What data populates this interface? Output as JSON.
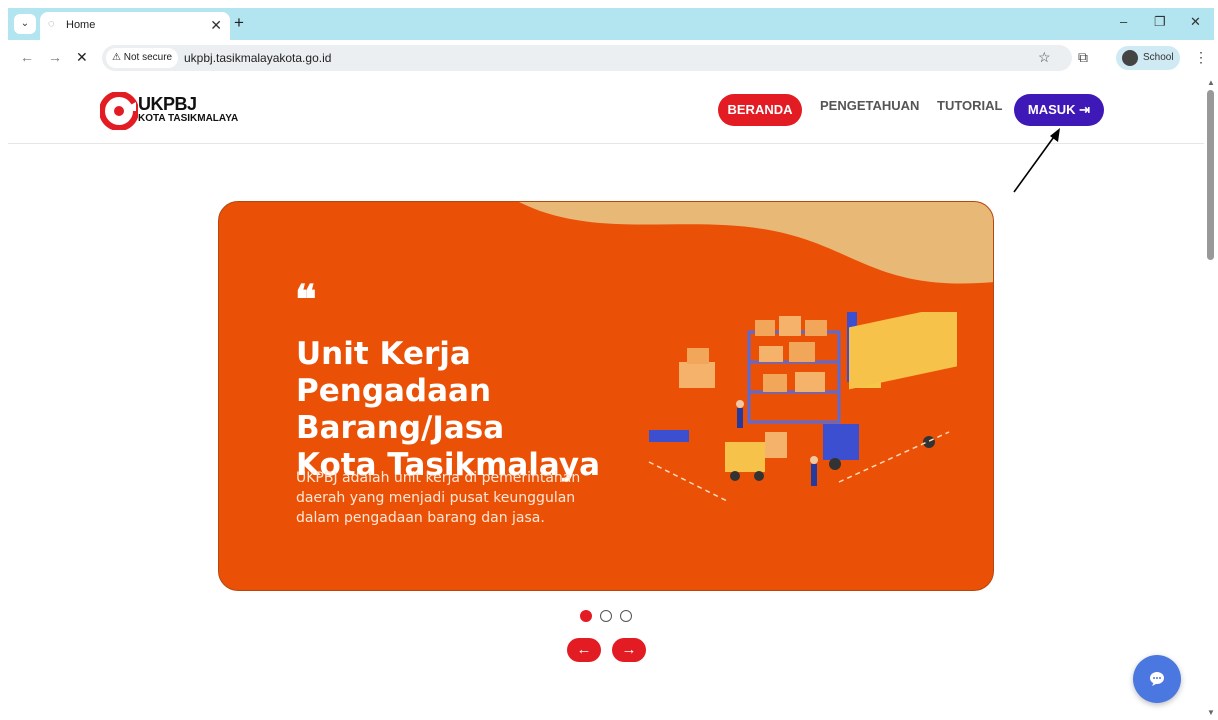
{
  "browser": {
    "tab_title": "Home",
    "tab_close": "✕",
    "new_tab": "+",
    "menu_caret": "⌄",
    "win_minimize": "–",
    "win_restore": "❐",
    "win_close": "✕",
    "back": "←",
    "forward": "→",
    "stop": "✕",
    "security_label": "⚠ Not secure",
    "url": "ukpbj.tasikmalayakota.go.id",
    "star": "☆",
    "extensions": "⧉",
    "profile_name": "School",
    "kebab": "⋮"
  },
  "site": {
    "logo_title": "UKPBJ",
    "logo_sub": "KOTA TASIKMALAYA",
    "nav": {
      "beranda": "BERANDA",
      "pengetahuan": "PENGETAHUAN",
      "tutorial": "TUTORIAL",
      "masuk": "MASUK ⇥"
    },
    "hero": {
      "quote_mark": "❝",
      "title_line1": "Unit Kerja Pengadaan",
      "title_line2": "Barang/Jasa",
      "title_line3": "Kota Tasikmalaya",
      "desc_line1": "UKPBJ adalah unit kerja di pemerintahan",
      "desc_line2": "daerah yang menjadi pusat keunggulan",
      "desc_line3": "dalam pengadaan barang dan jasa."
    },
    "carousel": {
      "prev": "←",
      "next": "→",
      "active_index": 0,
      "slide_count": 3
    }
  },
  "colors": {
    "brand_red": "#e31b23",
    "masuk_blue": "#3f18b8",
    "hero_orange": "#eb5106",
    "hero_sand": "#e8b877",
    "chat_blue": "#4a78e0"
  }
}
